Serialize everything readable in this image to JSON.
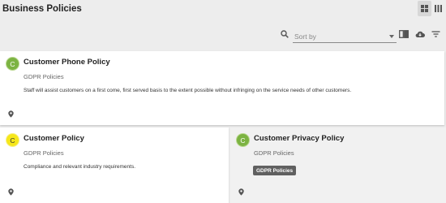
{
  "header": {
    "title": "Business Policies",
    "view_grid_icon": "grid-view-icon",
    "view_list_icon": "list-view-icon"
  },
  "toolbar": {
    "search_icon": "search-icon",
    "sort_placeholder": "Sort by",
    "icons": [
      "book-icon",
      "cloud-download-icon",
      "filter-icon"
    ]
  },
  "cards": [
    {
      "avatar": "C",
      "avatar_color": "#7cb342",
      "title": "Customer Phone Policy",
      "subtitle": "GDPR Policies",
      "description": "Staff will assist customers on a first come, first served basis to the extent possible without infringing on the service needs of other customers."
    },
    {
      "avatar": "C",
      "avatar_color": "#f6e71a",
      "title": "Customer Policy",
      "subtitle": "GDPR Policies",
      "description": "Compliance and relevant industry requirements."
    },
    {
      "avatar": "C",
      "avatar_color": "#7cb342",
      "title": "Customer Privacy Policy",
      "subtitle": "GDPR Policies",
      "chip": "GDPR Policies"
    }
  ]
}
